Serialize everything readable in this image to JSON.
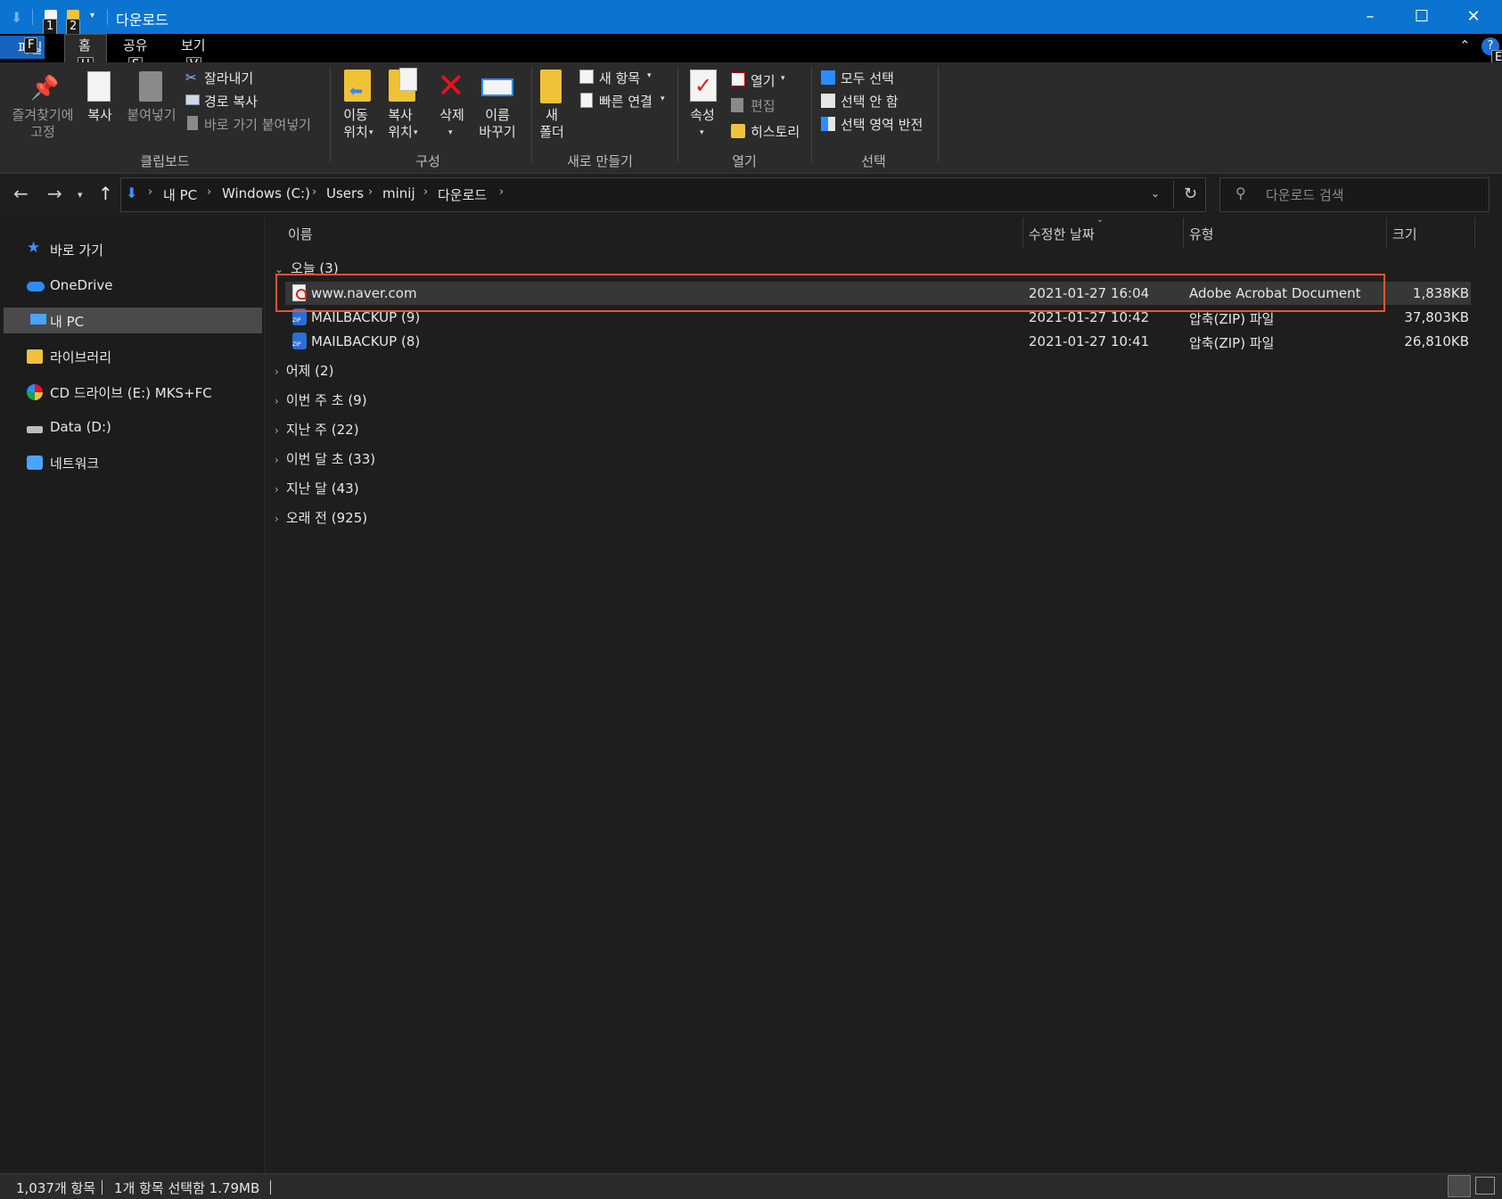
{
  "window": {
    "title": "다운로드",
    "quick_access_keytips": [
      "1",
      "2"
    ],
    "controls": {
      "minimize": "–",
      "maximize": "☐",
      "close": "✕"
    }
  },
  "ribbon_tabs": {
    "file": {
      "label": "파일",
      "keytip": "F"
    },
    "home": {
      "label": "홈",
      "keytip": "H"
    },
    "share": {
      "label": "공유",
      "keytip": "S"
    },
    "view": {
      "label": "보기",
      "keytip": "V"
    },
    "help_keytip": "E"
  },
  "ribbon": {
    "clipboard": {
      "title": "클립보드",
      "pin_label_1": "즐겨찾기에",
      "pin_label_2": "고정",
      "copy_label": "복사",
      "paste_label": "붙여넣기",
      "cut_label": "잘라내기",
      "copy_path_label": "경로 복사",
      "paste_shortcut_label": "바로 가기 붙여넣기"
    },
    "organize": {
      "title": "구성",
      "move_to_1": "이동",
      "move_to_2": "위치",
      "copy_to_1": "복사",
      "copy_to_2": "위치",
      "delete_label": "삭제",
      "rename_1": "이름",
      "rename_2": "바꾸기"
    },
    "new": {
      "title": "새로 만들기",
      "new_folder_1": "새",
      "new_folder_2": "폴더",
      "new_item_label": "새 항목",
      "easy_access_label": "빠른 연결"
    },
    "open": {
      "title": "열기",
      "properties_label": "속성",
      "open_label": "열기",
      "edit_label": "편집",
      "history_label": "히스토리"
    },
    "select": {
      "title": "선택",
      "select_all_label": "모두 선택",
      "select_none_label": "선택 안 함",
      "invert_label": "선택 영역 반전"
    }
  },
  "address": {
    "crumbs": [
      "내 PC",
      "Windows (C:)",
      "Users",
      "minij",
      "다운로드"
    ],
    "search_placeholder": "다운로드 검색"
  },
  "sidebar": {
    "items": [
      {
        "label": "바로 가기",
        "icon": "star-icon"
      },
      {
        "label": "OneDrive",
        "icon": "cloud-icon"
      },
      {
        "label": "내 PC",
        "icon": "computer-icon"
      },
      {
        "label": "라이브러리",
        "icon": "library-icon"
      },
      {
        "label": "CD 드라이브 (E:) MKS+FC",
        "icon": "cd-drive-icon"
      },
      {
        "label": "Data (D:)",
        "icon": "drive-icon"
      },
      {
        "label": "네트워크",
        "icon": "network-icon"
      }
    ]
  },
  "columns": {
    "name": "이름",
    "modified": "수정한 날짜",
    "type": "유형",
    "size": "크기"
  },
  "groups": {
    "today": "오늘 (3)",
    "yesterday": "어제 (2)",
    "early_this_week": "이번 주 초 (9)",
    "last_week": "지난 주 (22)",
    "early_this_month": "이번 달 초 (33)",
    "last_month": "지난 달 (43)",
    "long_ago": "오래 전 (925)"
  },
  "files": [
    {
      "name": "www.naver.com",
      "modified": "2021-01-27 16:04",
      "type": "Adobe Acrobat Document",
      "size": "1,838KB",
      "icon": "pdf-icon"
    },
    {
      "name": "MAILBACKUP (9)",
      "modified": "2021-01-27 10:42",
      "type": "압축(ZIP) 파일",
      "size": "37,803KB",
      "icon": "zip-icon"
    },
    {
      "name": "MAILBACKUP (8)",
      "modified": "2021-01-27 10:41",
      "type": "압축(ZIP) 파일",
      "size": "26,810KB",
      "icon": "zip-icon"
    }
  ],
  "status": {
    "item_count": "1,037개 항목",
    "selection": "1개 항목 선택함 1.79MB"
  },
  "colors": {
    "titlebar": "#0a74d0",
    "highlight_box": "#e8552b",
    "selected_row": "#373737"
  }
}
